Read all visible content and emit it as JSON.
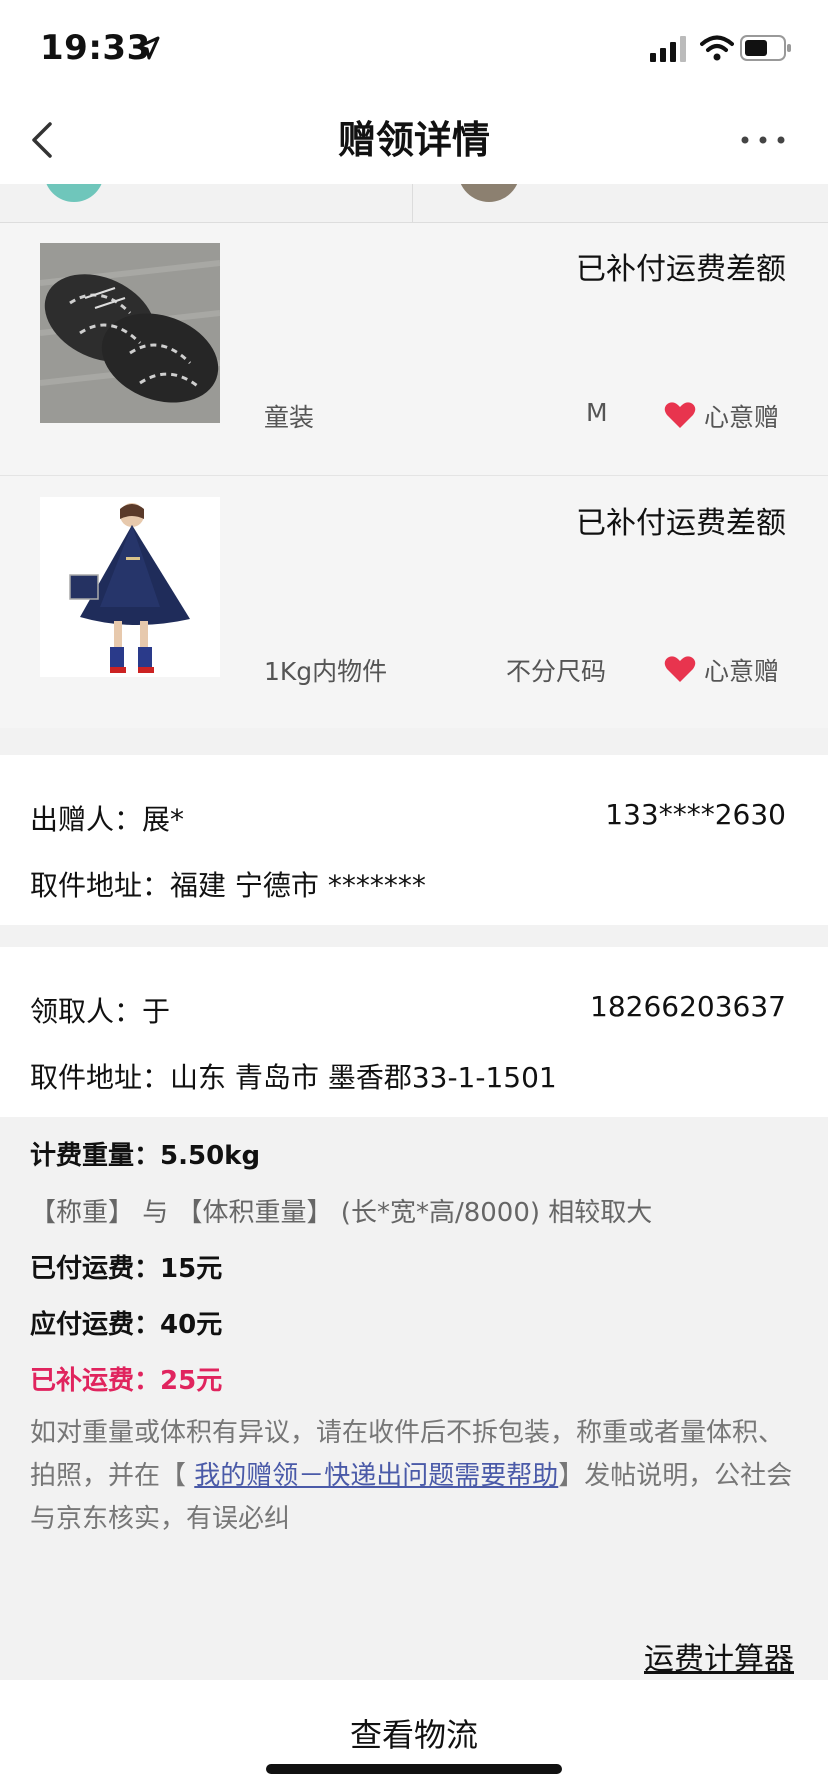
{
  "status_bar": {
    "time": "19:33"
  },
  "nav": {
    "title": "赠领详情"
  },
  "items": [
    {
      "status": "已补付运费差额",
      "category": "童装",
      "size": "M",
      "tag": "心意赠"
    },
    {
      "status": "已补付运费差额",
      "category": "1Kg内物件",
      "size": "不分尺码",
      "tag": "心意赠"
    }
  ],
  "sender": {
    "label": "出赠人：",
    "name": "展*",
    "phone": "133****2630",
    "address_label": "取件地址：",
    "address": "福建 宁德市 *******"
  },
  "receiver": {
    "label": "领取人：",
    "name": "于",
    "phone": "18266203637",
    "address_label": "取件地址：",
    "address": "山东 青岛市 墨香郡33-1-1501"
  },
  "fee": {
    "weight_label": "计费重量：",
    "weight": "5.50kg",
    "hint": "【称重】 与 【体积重量】 (长*宽*高/8000) 相较取大",
    "paid_label": "已付运费：",
    "paid": "15元",
    "due_label": "应付运费：",
    "due": "40元",
    "extra_label": "已补运费：",
    "extra": "25元",
    "notice_a": "如对重量或体积有异议，请在收件后不拆包装，称重或者量体积、拍照，并在【 ",
    "notice_link": "我的赠领－快递出问题需要帮助",
    "notice_b": "】发帖说明，公社会与京东核实，有误必纠"
  },
  "calculator_link": "运费计算器",
  "bottom_button": "查看物流",
  "colors": {
    "accent_red": "#e0245e",
    "link_blue": "#4a5aa8",
    "heart_red": "#e8344e"
  }
}
